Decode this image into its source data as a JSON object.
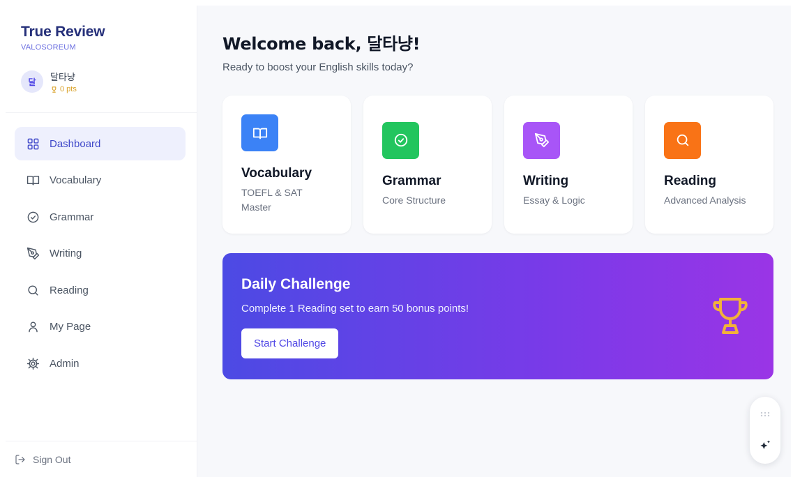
{
  "sidebar": {
    "brand_title": "True Review",
    "brand_subtitle": "VALOSOREUM",
    "user": {
      "avatar_initial": "달",
      "name": "달타냥",
      "points": "0 pts"
    },
    "nav": [
      {
        "label": "Dashboard",
        "icon": "grid-icon",
        "active": true
      },
      {
        "label": "Vocabulary",
        "icon": "book-icon"
      },
      {
        "label": "Grammar",
        "icon": "check-circle-icon"
      },
      {
        "label": "Writing",
        "icon": "pen-tool-icon"
      },
      {
        "label": "Reading",
        "icon": "search-icon"
      },
      {
        "label": "My Page",
        "icon": "user-icon"
      },
      {
        "label": "Admin",
        "icon": "gear-icon"
      }
    ],
    "sign_out": "Sign Out"
  },
  "main": {
    "welcome_title": "Welcome back, 달타냥!",
    "welcome_subtitle": "Ready to boost your English skills today?",
    "cards": [
      {
        "title": "Vocabulary",
        "subtitle": "TOEFL & SAT Master",
        "icon": "book-icon",
        "color": "#3b82f6"
      },
      {
        "title": "Grammar",
        "subtitle": "Core Structure",
        "icon": "check-circle-icon",
        "color": "#22c55e"
      },
      {
        "title": "Writing",
        "subtitle": "Essay & Logic",
        "icon": "pen-tool-icon",
        "color": "#a855f7"
      },
      {
        "title": "Reading",
        "subtitle": "Advanced Analysis",
        "icon": "search-icon",
        "color": "#f97316"
      }
    ],
    "challenge": {
      "title": "Daily Challenge",
      "description": "Complete 1 Reading set to earn 50 bonus points!",
      "button": "Start Challenge",
      "icon": "trophy-icon",
      "icon_color": "#f2b13a"
    }
  },
  "floating_widget": {
    "handle_icon": "drag-handle-icon",
    "action_icon": "sparkle-icon"
  },
  "colors": {
    "brand": "#26307a",
    "accent": "#4f46e5",
    "active_bg": "#eef0fd",
    "points": "#d9a128"
  }
}
